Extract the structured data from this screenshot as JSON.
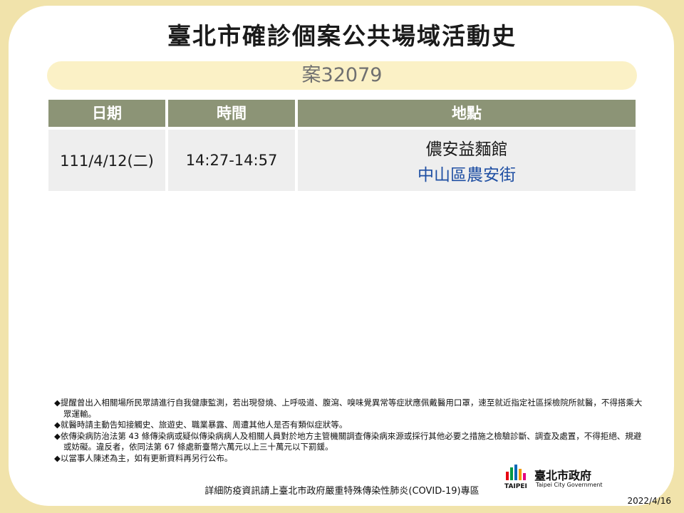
{
  "title": "臺北市確診個案公共場域活動史",
  "case_label": "案32079",
  "table": {
    "headers": [
      "日期",
      "時間",
      "地點"
    ],
    "rows": [
      {
        "date": "111/4/12(二)",
        "time": "14:27-14:57",
        "venue": "儂安益麵館",
        "district": "中山區農安街"
      }
    ]
  },
  "notes": [
    "◆提醒曾出入相關場所民眾請進行自我健康監測，若出現發燒、上呼吸道、腹瀉、嗅味覺異常等症狀應佩戴醫用口罩，速至就近指定社區採檢院所就醫，不得搭乘大眾運輸。",
    "◆就醫時請主動告知接觸史、旅遊史、職業暴露、周遭其他人是否有類似症狀等。",
    "◆依傳染病防治法第 43 條傳染病或疑似傳染病病人及相關人員對於地方主管機關調查傳染病來源或採行其他必要之措施之檢驗診斷、調查及處置，不得拒絕、規避或妨礙。違反者，依同法第 67 條處新臺幣六萬元以上三十萬元以下罰鍰。",
    "◆以當事人陳述為主，如有更新資料再另行公布。"
  ],
  "footer": "詳細防疫資訊請上臺北市政府嚴重特殊傳染性肺炎(COVID-19)專區",
  "logo": {
    "name": "臺北市政府",
    "sub": "Taipei City Government",
    "wordmark": "TAIPEI"
  },
  "date": "2022/4/16",
  "colors": {
    "background": "#f1e3ab",
    "header": "#8c9476",
    "cell": "#eeeeee",
    "district": "#1f4fa3"
  }
}
